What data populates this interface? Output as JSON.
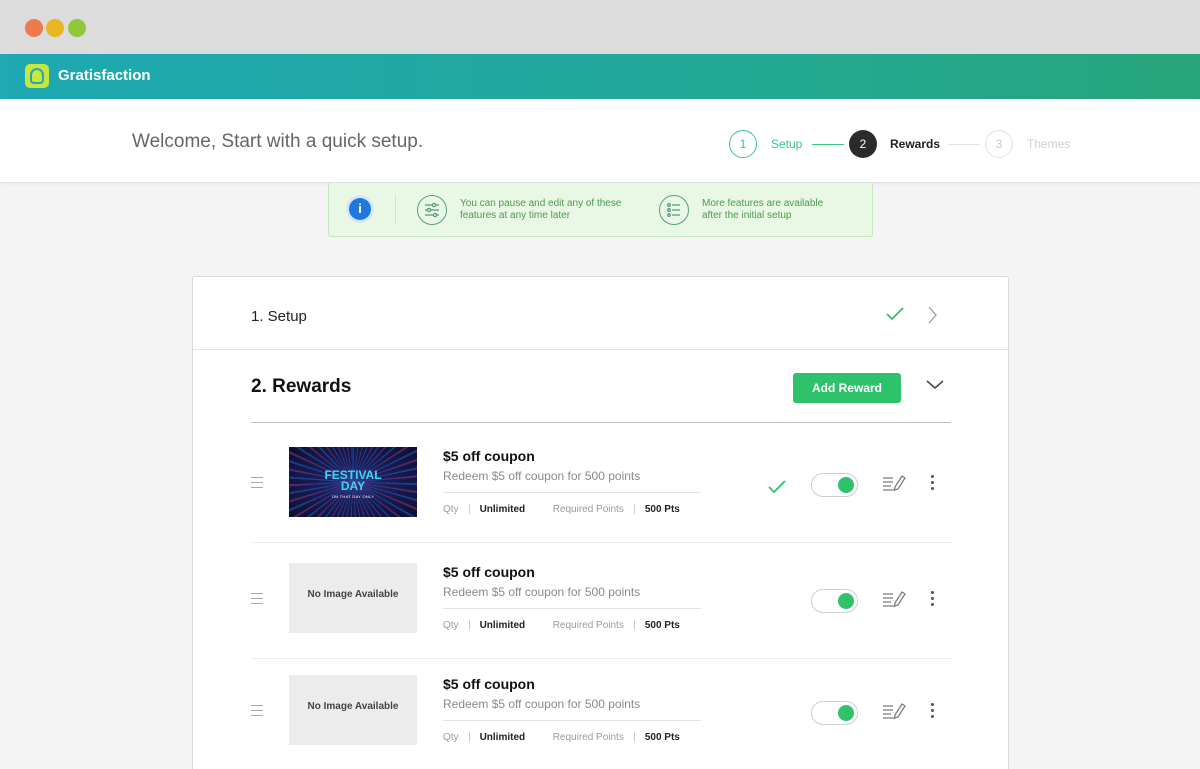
{
  "app": {
    "name": "Gratisfaction"
  },
  "header": {
    "welcome": "Welcome, Start with a quick setup."
  },
  "steps": [
    {
      "number": "1",
      "label": "Setup",
      "state": "completed"
    },
    {
      "number": "2",
      "label": "Rewards",
      "state": "active"
    },
    {
      "number": "3",
      "label": "Themes",
      "state": "upcoming"
    }
  ],
  "info": {
    "icon": "i",
    "tips": [
      {
        "icon": "sliders-icon",
        "text": "You can pause and edit any of these features at any time later"
      },
      {
        "icon": "list-icon",
        "text": "More features are available after the initial setup"
      }
    ]
  },
  "sections": {
    "setup": {
      "title": "1. Setup",
      "completed": true
    },
    "rewards": {
      "title": "2. Rewards",
      "add_button": "Add Reward"
    }
  },
  "rewards": [
    {
      "title": "$5 off coupon",
      "description": "Redeem $5 off coupon for 500 points",
      "qty_label": "Qty",
      "qty": "Unlimited",
      "points_label": "Required Points",
      "points": "500 Pts",
      "image": {
        "type": "festival",
        "line1": "FESTIVAL",
        "line2": "DAY",
        "line3": "ON THAT DAY ONLY"
      },
      "checked": true,
      "enabled": true
    },
    {
      "title": "$5 off coupon",
      "description": "Redeem $5 off coupon for 500 points",
      "qty_label": "Qty",
      "qty": "Unlimited",
      "points_label": "Required Points",
      "points": "500 Pts",
      "image": {
        "type": "none",
        "text": "No Image Available"
      },
      "checked": false,
      "enabled": true
    },
    {
      "title": "$5 off coupon",
      "description": "Redeem $5 off coupon for 500 points",
      "qty_label": "Qty",
      "qty": "Unlimited",
      "points_label": "Required Points",
      "points": "500 Pts",
      "image": {
        "type": "none",
        "text": "No Image Available"
      },
      "checked": false,
      "enabled": true
    }
  ],
  "colors": {
    "accent": "#2ec26b",
    "header_start": "#1ea9b3",
    "header_end": "#27a57a",
    "info_bg": "#e9f8e4"
  }
}
